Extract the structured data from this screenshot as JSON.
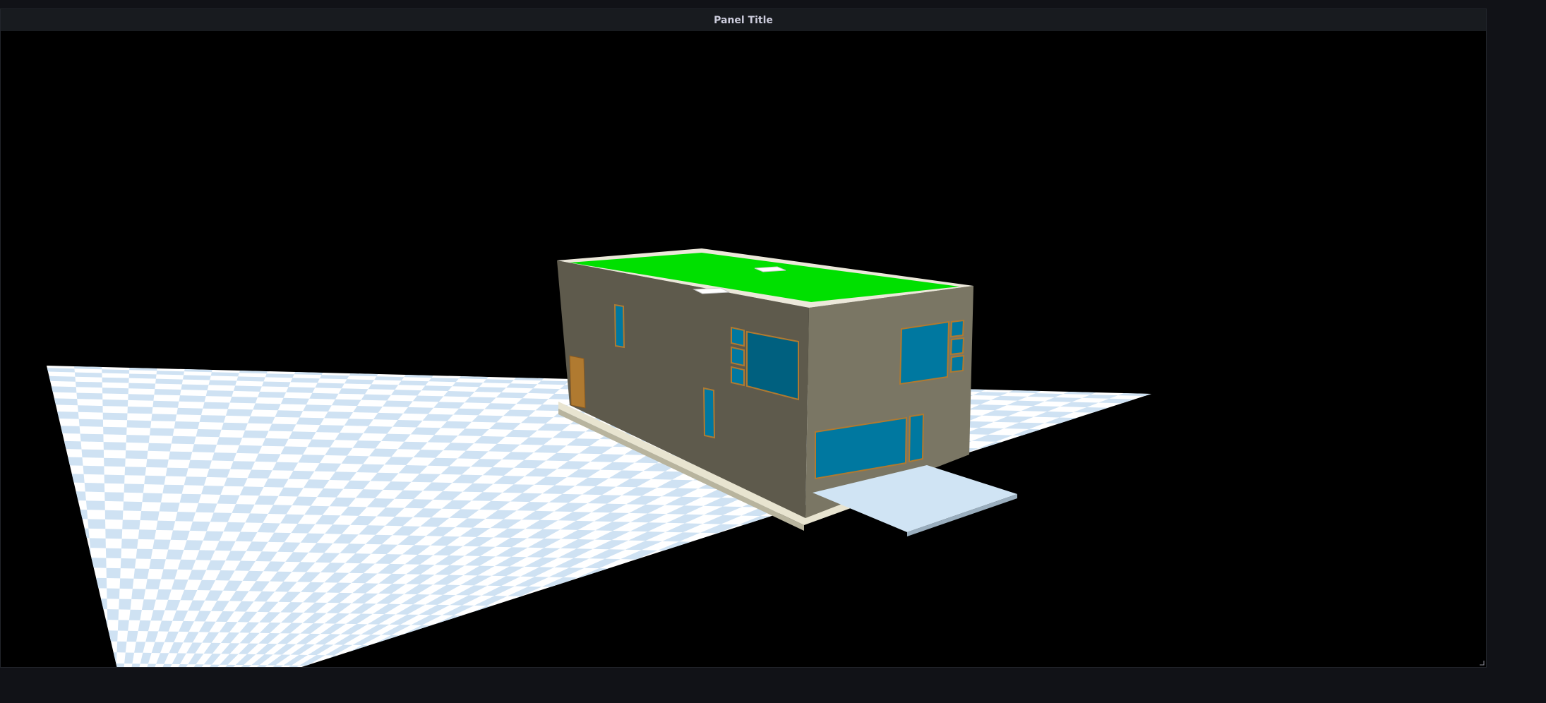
{
  "panel": {
    "title": "Panel Title"
  },
  "scene": {
    "background_color": "#000000",
    "floor_colors": [
      "#ffffff",
      "#cfe2f3"
    ],
    "roof_color": "#00e000",
    "wall_front_color": "#5e5a4c",
    "wall_side_color": "#7a7664",
    "window_color": "#0078a0",
    "door_color": "#b07a30",
    "terrace_color": "#d0e4f4",
    "base_color": "#e8e4d0"
  },
  "icons": {
    "resize": "resize-corner-icon"
  }
}
